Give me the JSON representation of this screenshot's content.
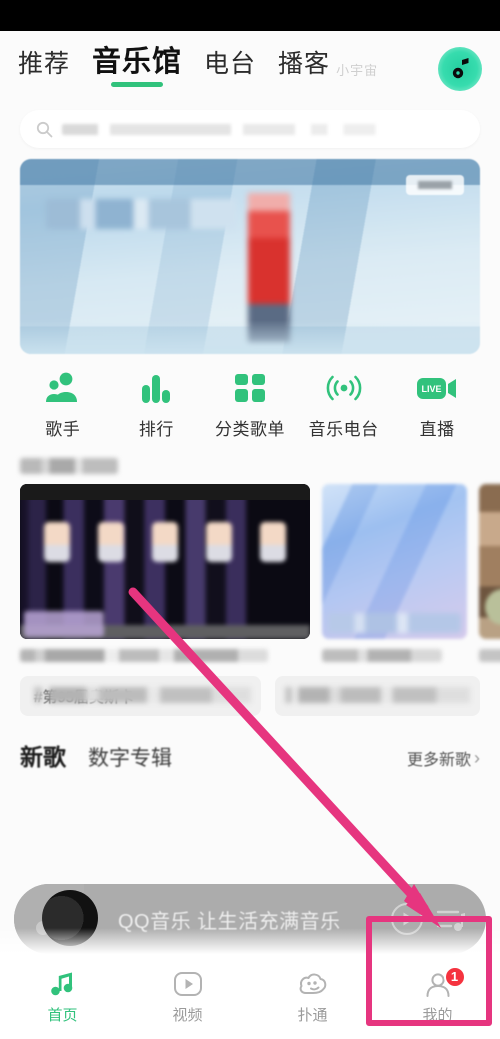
{
  "app": {
    "name": "QQ音乐",
    "accent_green": "#31c27c",
    "annotation_pink": "#e6357f",
    "badge_red": "#f5333f"
  },
  "topbar": {
    "tabs": [
      {
        "label": "推荐",
        "active": false
      },
      {
        "label": "音乐馆",
        "active": true
      },
      {
        "label": "电台",
        "active": false
      },
      {
        "label": "播客",
        "active": false
      }
    ],
    "superscript_label": "小宇宙",
    "logo_icon": "music-note-logo-icon"
  },
  "search": {
    "icon": "search-icon",
    "placeholder": "",
    "value": ""
  },
  "banner": {
    "icon": "banner-image",
    "tag_label": ""
  },
  "categories": [
    {
      "label": "歌手",
      "icon": "singer-icon"
    },
    {
      "label": "排行",
      "icon": "ranking-bars-icon"
    },
    {
      "label": "分类歌单",
      "icon": "grid-squares-icon"
    },
    {
      "label": "音乐电台",
      "icon": "radio-waves-icon"
    },
    {
      "label": "直播",
      "icon": "live-camera-icon"
    }
  ],
  "section": {
    "title": "",
    "cards": [
      {
        "name": "card-mv-group",
        "meta_1": "",
        "meta_2": ""
      },
      {
        "name": "card-blue-album",
        "meta_1": ""
      },
      {
        "name": "card-partial",
        "meta_1": ""
      }
    ]
  },
  "tags": [
    {
      "text": "#第95届奥斯卡"
    },
    {
      "text": ""
    }
  ],
  "new_songs": {
    "tab_new": "新歌",
    "tab_digital_album": "数字专辑",
    "more_label": "更多新歌",
    "more_chevron": "chevron-right-icon"
  },
  "mini_player": {
    "album_art_icon": "music-note-icon",
    "title": "QQ音乐 让生活充满音乐",
    "play_icon": "play-circle-icon",
    "playlist_icon": "playlist-icon"
  },
  "bottom_nav": [
    {
      "label": "首页",
      "icon": "music-note-icon",
      "active": true,
      "badge": ""
    },
    {
      "label": "视频",
      "icon": "video-play-icon",
      "active": false,
      "badge": ""
    },
    {
      "label": "扑通",
      "icon": "cloud-face-icon",
      "active": false,
      "badge": ""
    },
    {
      "label": "我的",
      "icon": "profile-icon",
      "active": false,
      "badge": "1"
    }
  ],
  "annotations": {
    "highlight_box": "my-tab-highlight",
    "arrow": "pointer-arrow"
  }
}
